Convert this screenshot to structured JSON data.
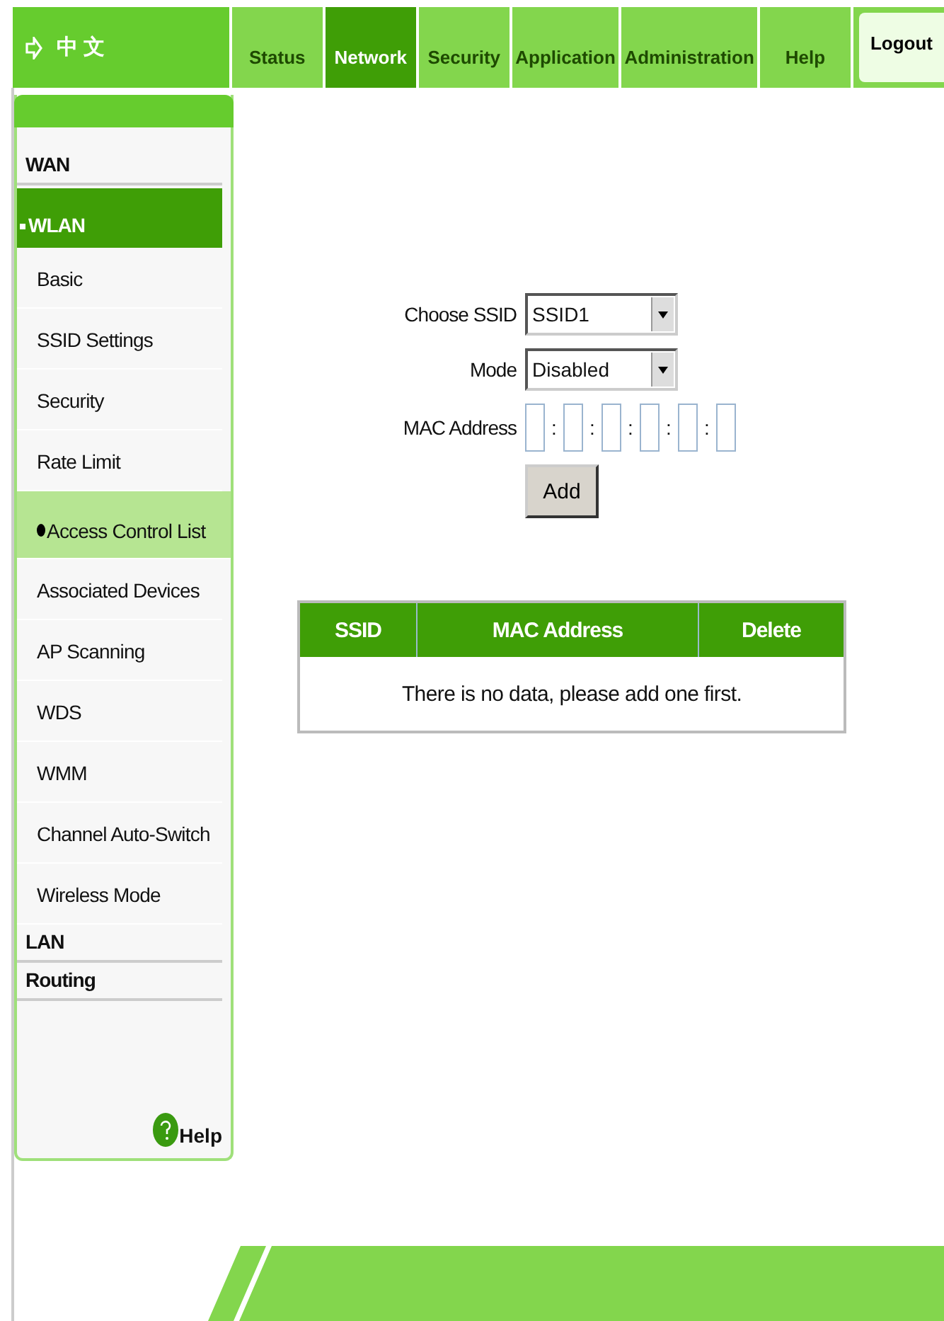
{
  "header": {
    "language_label": "中 文"
  },
  "tabs": [
    {
      "label": "Status",
      "selected": false
    },
    {
      "label": "Network",
      "selected": true
    },
    {
      "label": "Security",
      "selected": false
    },
    {
      "label": "Application",
      "selected": false
    },
    {
      "label": "Administration",
      "selected": false
    },
    {
      "label": "Help",
      "selected": false
    }
  ],
  "logout": "Logout",
  "sidebar": {
    "items": [
      {
        "label": "WAN",
        "selected": false
      },
      {
        "label": "WLAN",
        "selected": true,
        "children": [
          {
            "label": "Basic",
            "selected": false
          },
          {
            "label": "SSID Settings",
            "selected": false
          },
          {
            "label": "Security",
            "selected": false
          },
          {
            "label": "Rate Limit",
            "selected": false
          },
          {
            "label": "Access Control List",
            "selected": true
          },
          {
            "label": "Associated Devices",
            "selected": false
          },
          {
            "label": "AP Scanning",
            "selected": false
          },
          {
            "label": "WDS",
            "selected": false
          },
          {
            "label": "WMM",
            "selected": false
          },
          {
            "label": "Channel Auto-Switch",
            "selected": false
          },
          {
            "label": "Wireless Mode",
            "selected": false
          }
        ]
      },
      {
        "label": "LAN",
        "selected": false
      },
      {
        "label": "Routing",
        "selected": false
      }
    ],
    "help": "Help"
  },
  "form": {
    "choose_ssid": {
      "label": "Choose SSID",
      "value": "SSID1"
    },
    "mode": {
      "label": "Mode",
      "value": "Disabled"
    },
    "mac_address": {
      "label": "MAC Address",
      "separator": ":"
    },
    "add_button": "Add"
  },
  "table": {
    "columns": [
      "SSID",
      "MAC Address",
      "Delete"
    ],
    "empty_message": "There is no data, please add one first."
  }
}
